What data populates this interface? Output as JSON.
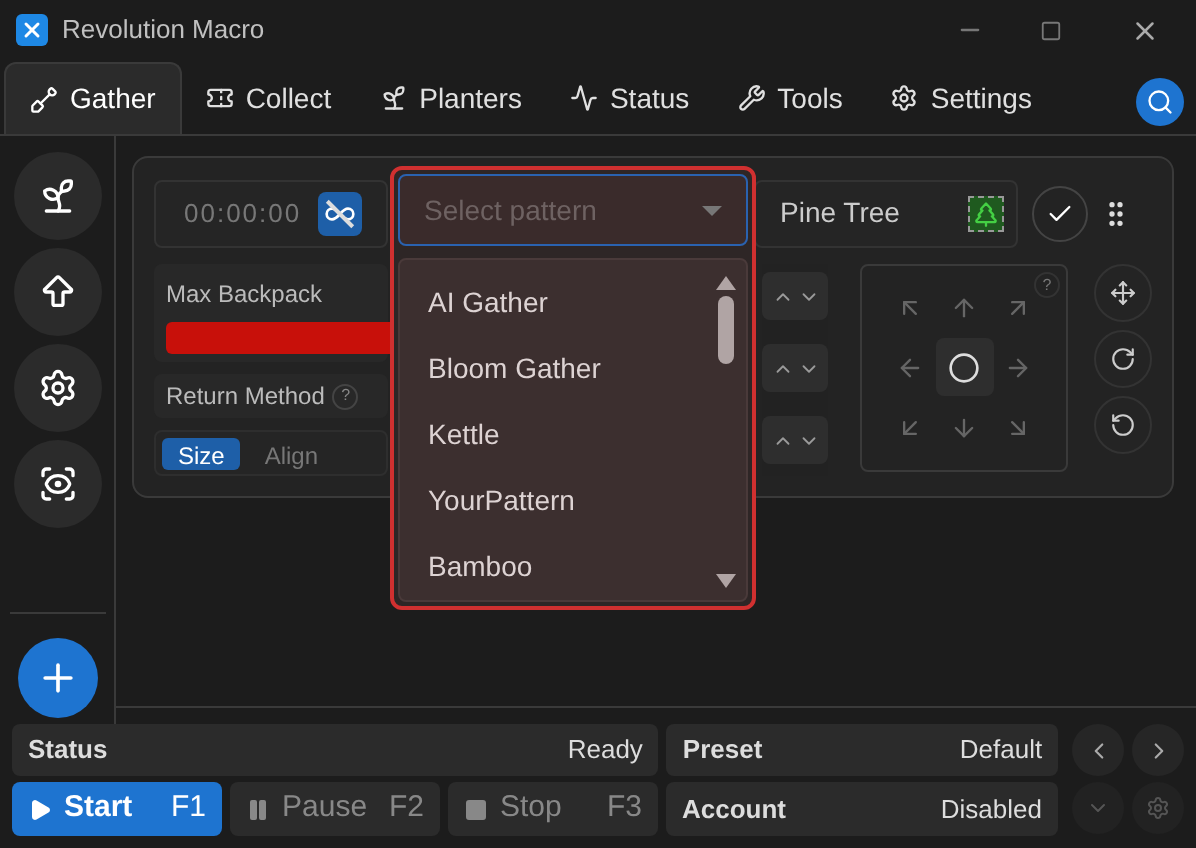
{
  "window": {
    "title": "Revolution Macro"
  },
  "tabs": [
    {
      "label": "Gather",
      "selected": true
    },
    {
      "label": "Collect",
      "selected": false
    },
    {
      "label": "Planters",
      "selected": false
    },
    {
      "label": "Status",
      "selected": false
    },
    {
      "label": "Tools",
      "selected": false
    },
    {
      "label": "Settings",
      "selected": false
    }
  ],
  "gather": {
    "timer": "00:00:00",
    "infinite_loop": true,
    "pattern_select": {
      "placeholder": "Select pattern",
      "expanded": true,
      "options": [
        "AI Gather",
        "Bloom Gather",
        "Kettle",
        "YourPattern",
        "Bamboo"
      ]
    },
    "field": "Pine Tree",
    "max_backpack": {
      "label": "Max Backpack"
    },
    "return_method": {
      "label": "Return Method",
      "help": "?",
      "options": [
        {
          "label": "Size",
          "selected": true
        },
        {
          "label": "Align",
          "selected": false
        }
      ]
    },
    "direction_help": "?"
  },
  "status_bar": {
    "status": {
      "label": "Status",
      "value": "Ready"
    },
    "preset": {
      "label": "Preset",
      "value": "Default"
    },
    "account": {
      "label": "Account",
      "value": "Disabled"
    },
    "controls": [
      {
        "label": "Start",
        "key": "F1",
        "selected": true
      },
      {
        "label": "Pause",
        "key": "F2",
        "selected": false
      },
      {
        "label": "Stop",
        "key": "F3",
        "selected": false
      }
    ]
  }
}
